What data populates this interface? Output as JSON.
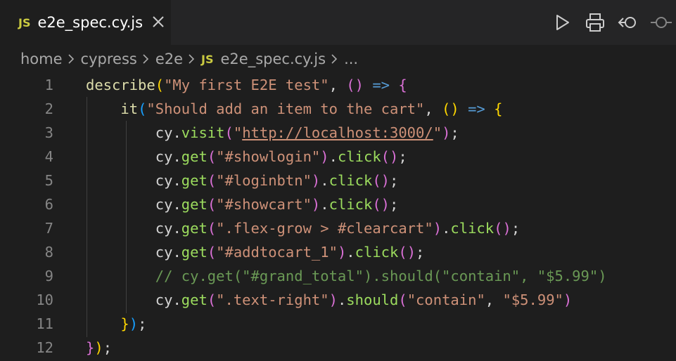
{
  "tab": {
    "file_type": "JS",
    "filename": "e2e_spec.cy.js"
  },
  "breadcrumb": {
    "items": [
      "home",
      "cypress",
      "e2e"
    ],
    "file_type": "JS",
    "file": "e2e_spec.cy.js",
    "more": "..."
  },
  "editor": {
    "line_numbers": [
      "1",
      "2",
      "3",
      "4",
      "5",
      "6",
      "7",
      "8",
      "9",
      "10",
      "11",
      "12"
    ],
    "lines": [
      [
        [
          "fn",
          "describe"
        ],
        [
          "p1",
          "("
        ],
        [
          "str",
          "\"My first E2E test\""
        ],
        [
          "plain",
          ", "
        ],
        [
          "p2",
          "()"
        ],
        [
          "plain",
          " "
        ],
        [
          "arrow",
          "=>"
        ],
        [
          "plain",
          " "
        ],
        [
          "p2",
          "{"
        ]
      ],
      [
        [
          "plain",
          "    "
        ],
        [
          "fn",
          "it"
        ],
        [
          "p3",
          "("
        ],
        [
          "str",
          "\"Should add an item to the cart\""
        ],
        [
          "plain",
          ", "
        ],
        [
          "p1",
          "()"
        ],
        [
          "plain",
          " "
        ],
        [
          "arrow",
          "=>"
        ],
        [
          "plain",
          " "
        ],
        [
          "p1",
          "{"
        ]
      ],
      [
        [
          "plain",
          "        "
        ],
        [
          "var",
          "cy"
        ],
        [
          "plain",
          "."
        ],
        [
          "callg",
          "visit"
        ],
        [
          "p2",
          "("
        ],
        [
          "str",
          "\""
        ],
        [
          "url",
          "http://localhost:3000/"
        ],
        [
          "str",
          "\""
        ],
        [
          "p2",
          ")"
        ],
        [
          "plain",
          ";"
        ]
      ],
      [
        [
          "plain",
          "        "
        ],
        [
          "var",
          "cy"
        ],
        [
          "plain",
          "."
        ],
        [
          "callg",
          "get"
        ],
        [
          "p2",
          "("
        ],
        [
          "str",
          "\"#showlogin\""
        ],
        [
          "p2",
          ")"
        ],
        [
          "plain",
          "."
        ],
        [
          "callg",
          "click"
        ],
        [
          "p2",
          "()"
        ],
        [
          "plain",
          ";"
        ]
      ],
      [
        [
          "plain",
          "        "
        ],
        [
          "var",
          "cy"
        ],
        [
          "plain",
          "."
        ],
        [
          "callg",
          "get"
        ],
        [
          "p2",
          "("
        ],
        [
          "str",
          "\"#loginbtn\""
        ],
        [
          "p2",
          ")"
        ],
        [
          "plain",
          "."
        ],
        [
          "callg",
          "click"
        ],
        [
          "p2",
          "()"
        ],
        [
          "plain",
          ";"
        ]
      ],
      [
        [
          "plain",
          "        "
        ],
        [
          "var",
          "cy"
        ],
        [
          "plain",
          "."
        ],
        [
          "callg",
          "get"
        ],
        [
          "p2",
          "("
        ],
        [
          "str",
          "\"#showcart\""
        ],
        [
          "p2",
          ")"
        ],
        [
          "plain",
          "."
        ],
        [
          "callg",
          "click"
        ],
        [
          "p2",
          "()"
        ],
        [
          "plain",
          ";"
        ]
      ],
      [
        [
          "plain",
          "        "
        ],
        [
          "var",
          "cy"
        ],
        [
          "plain",
          "."
        ],
        [
          "callg",
          "get"
        ],
        [
          "p2",
          "("
        ],
        [
          "str",
          "\".flex-grow > #clearcart\""
        ],
        [
          "p2",
          ")"
        ],
        [
          "plain",
          "."
        ],
        [
          "callg",
          "click"
        ],
        [
          "p2",
          "()"
        ],
        [
          "plain",
          ";"
        ]
      ],
      [
        [
          "plain",
          "        "
        ],
        [
          "var",
          "cy"
        ],
        [
          "plain",
          "."
        ],
        [
          "callg",
          "get"
        ],
        [
          "p2",
          "("
        ],
        [
          "str",
          "\"#addtocart_1\""
        ],
        [
          "p2",
          ")"
        ],
        [
          "plain",
          "."
        ],
        [
          "callg",
          "click"
        ],
        [
          "p2",
          "()"
        ],
        [
          "plain",
          ";"
        ]
      ],
      [
        [
          "plain",
          "        "
        ],
        [
          "cm",
          "// cy.get(\"#grand_total\").should(\"contain\", \"$5.99\")"
        ]
      ],
      [
        [
          "plain",
          "        "
        ],
        [
          "var",
          "cy"
        ],
        [
          "plain",
          "."
        ],
        [
          "callg",
          "get"
        ],
        [
          "p2",
          "("
        ],
        [
          "str",
          "\".text-right\""
        ],
        [
          "p2",
          ")"
        ],
        [
          "plain",
          "."
        ],
        [
          "callg",
          "should"
        ],
        [
          "p2",
          "("
        ],
        [
          "str",
          "\"contain\""
        ],
        [
          "plain",
          ", "
        ],
        [
          "str",
          "\"$5.99\""
        ],
        [
          "p2",
          ")"
        ]
      ],
      [
        [
          "plain",
          "    "
        ],
        [
          "p1",
          "}"
        ],
        [
          "p3",
          ")"
        ],
        [
          "plain",
          ";"
        ]
      ],
      [
        [
          "p2",
          "}"
        ],
        [
          "p1",
          ")"
        ],
        [
          "plain",
          ";"
        ]
      ]
    ]
  }
}
